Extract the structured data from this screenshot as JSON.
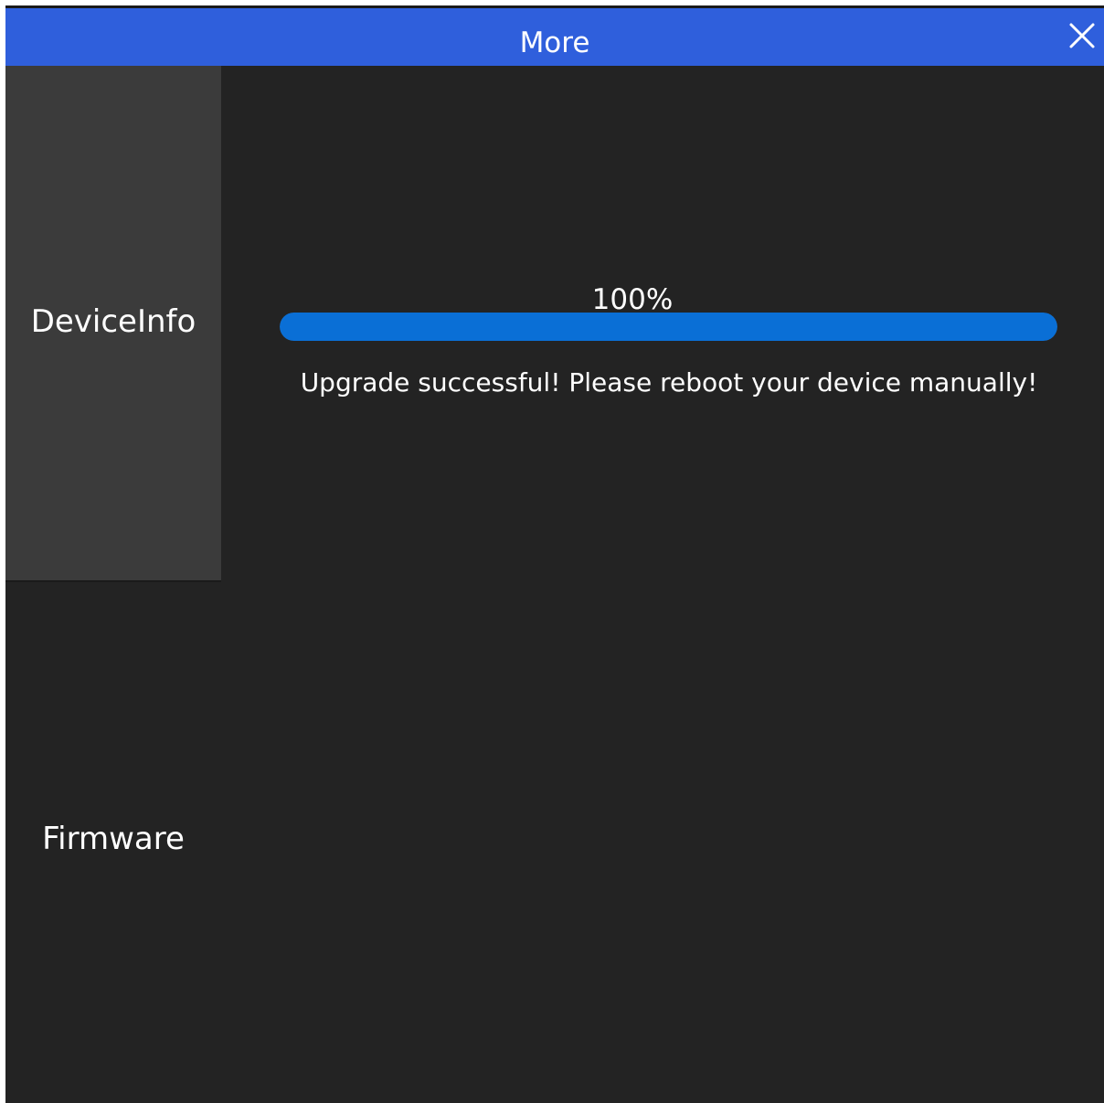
{
  "window": {
    "title": "More",
    "close_icon": "close-icon"
  },
  "sidebar": {
    "items": [
      {
        "label": "DeviceInfo",
        "active": true
      },
      {
        "label": "Firmware",
        "active": false
      }
    ]
  },
  "upgrade": {
    "progress_text": "100%",
    "progress_fraction": 1.0,
    "status": "Upgrade successful! Please reboot your device manually!"
  },
  "colors": {
    "title_bar": "#2f5fdc",
    "progress_fill": "#0a6fd6",
    "background": "#232323",
    "sidebar_active": "#3b3b3b"
  }
}
